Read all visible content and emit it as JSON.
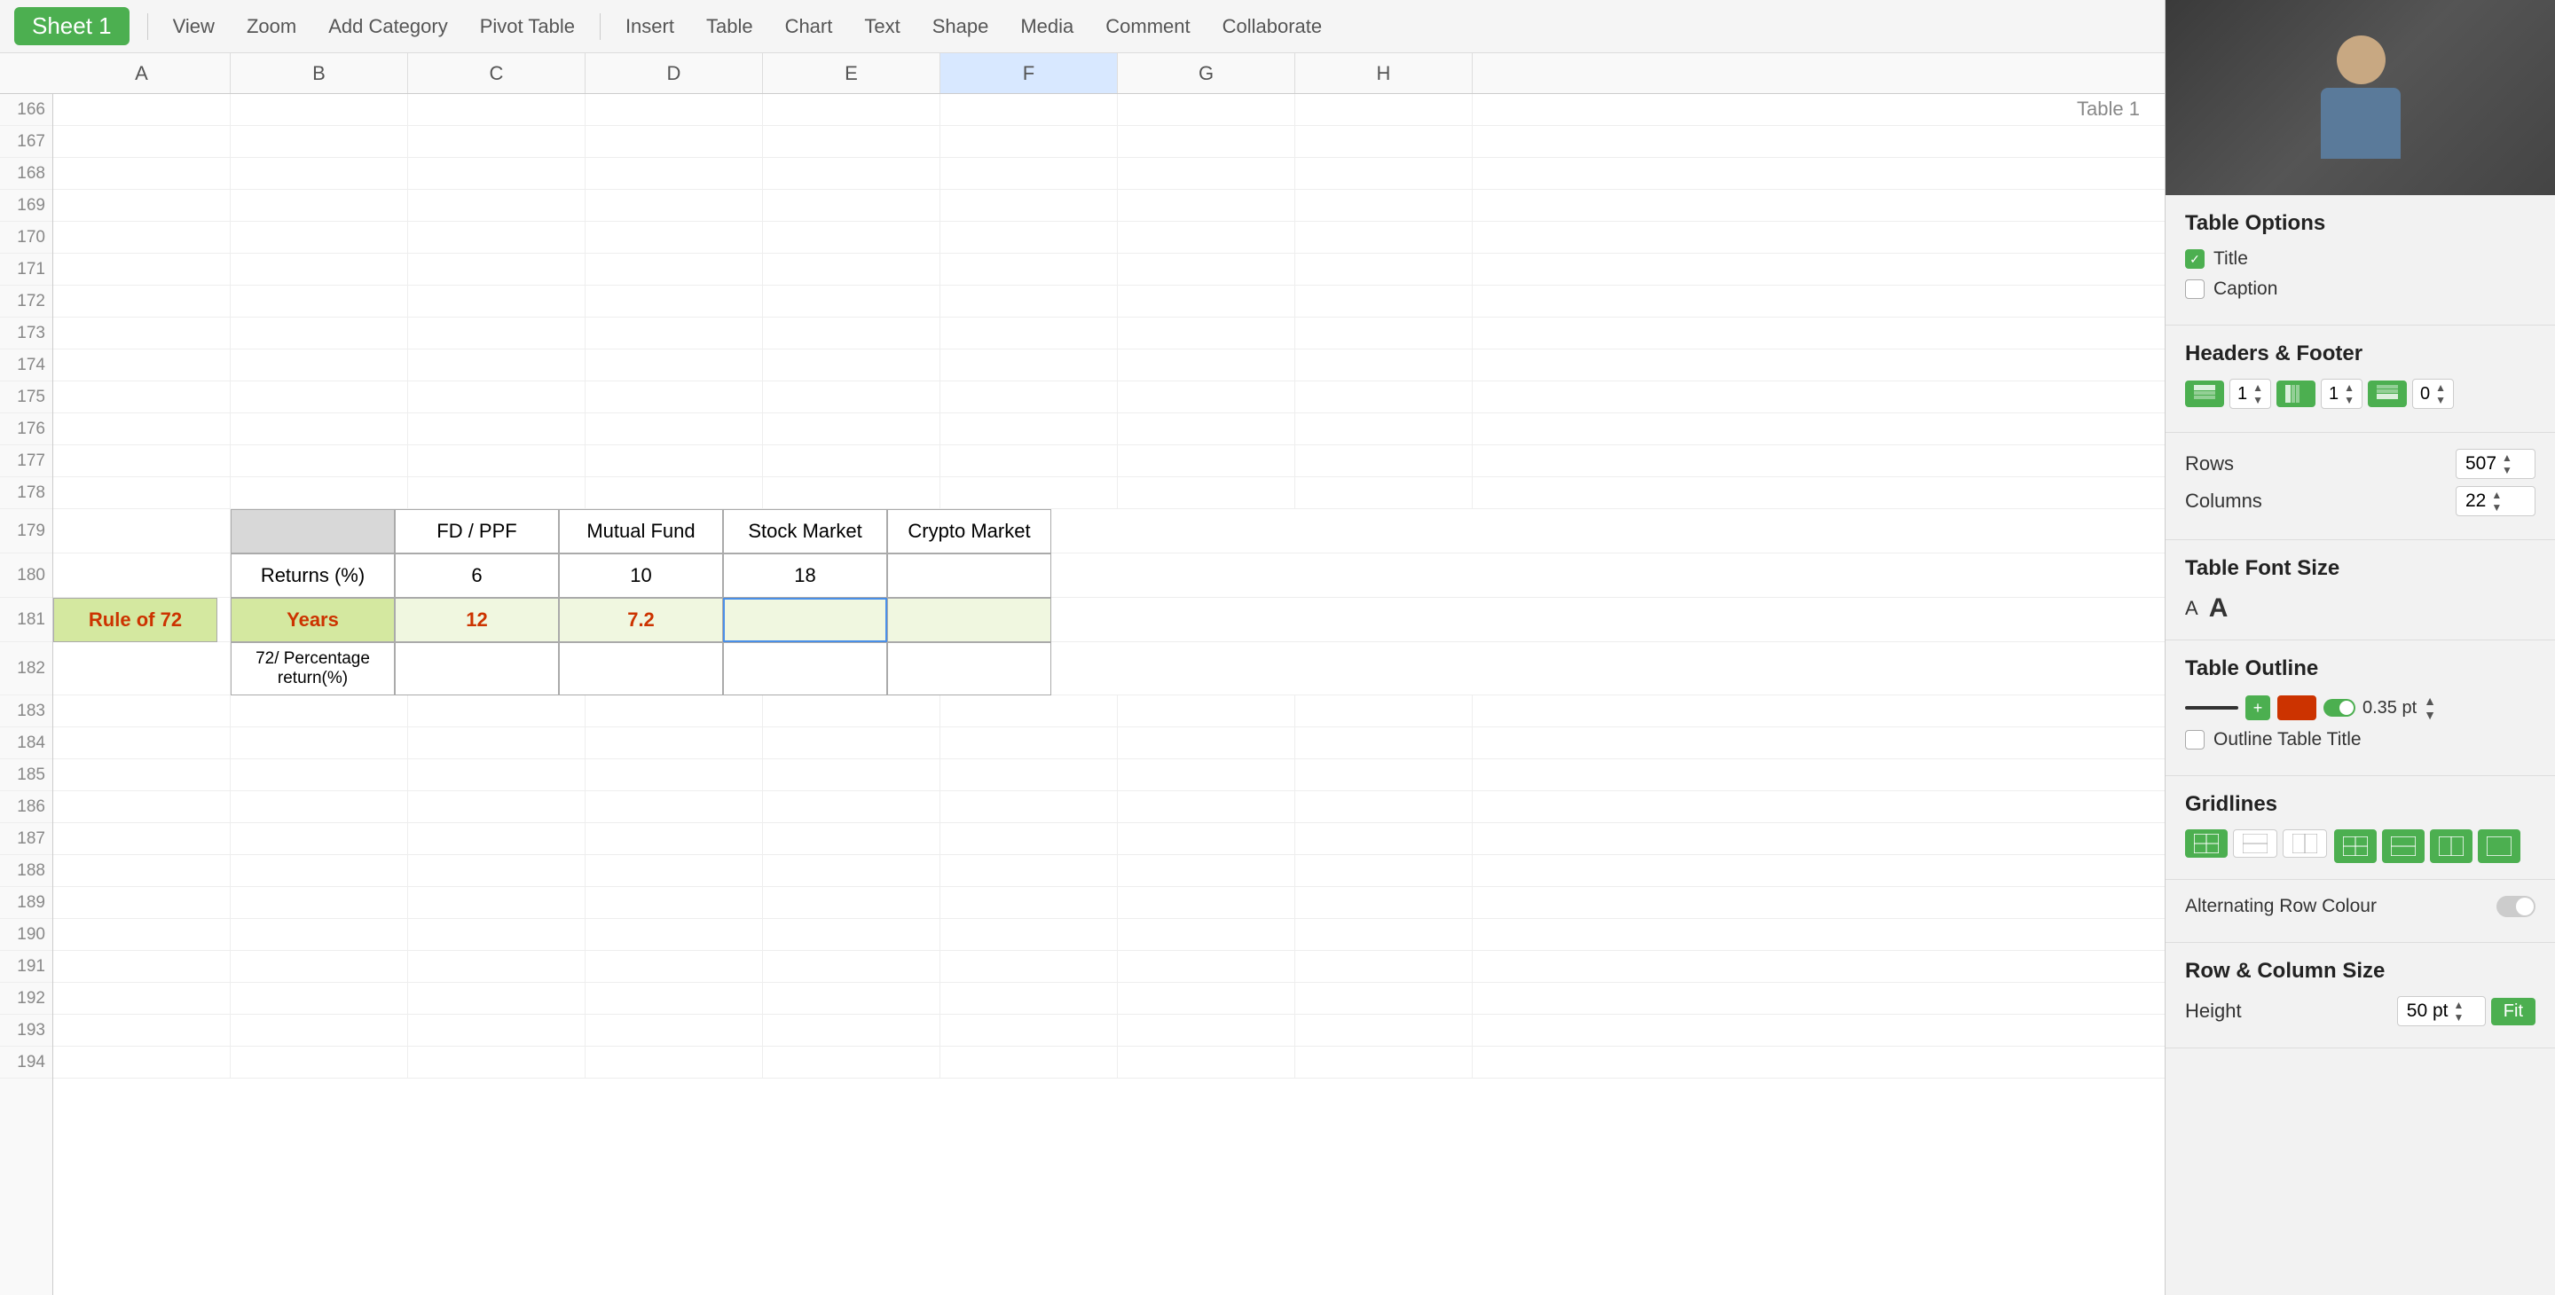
{
  "toolbar": {
    "sheet_tab": "Sheet 1",
    "buttons": [
      "View",
      "Zoom",
      "Add Category",
      "Pivot Table",
      "Insert",
      "Table",
      "Chart",
      "Text",
      "Shape",
      "Media",
      "Comment",
      "Collaborate"
    ]
  },
  "column_headers": [
    "A",
    "B",
    "C",
    "D",
    "E",
    "F",
    "G",
    "H"
  ],
  "row_numbers": [
    166,
    167,
    168,
    169,
    170,
    171,
    172,
    173,
    174,
    175,
    176,
    177,
    178,
    179,
    180,
    181,
    182,
    183,
    184,
    185,
    186,
    187,
    188,
    189,
    190,
    191,
    192,
    193,
    194
  ],
  "table_title": "Table 1",
  "data_table": {
    "header_row": [
      "",
      "FD / PPF",
      "Mutual Fund",
      "Stock Market",
      "Crypto Market"
    ],
    "row_returns": [
      "Returns (%)",
      "6",
      "10",
      "18",
      ""
    ],
    "row_years": [
      "Years",
      "12",
      "7.2",
      "",
      ""
    ],
    "row_formula": [
      "72/ Percentage return(%)",
      "",
      "",
      "",
      ""
    ],
    "row_rule72_label": "Rule of 72"
  },
  "right_panel": {
    "section_table_options": {
      "title": "Table Options",
      "title_checked": true,
      "caption_checked": false,
      "title_label": "Title",
      "caption_label": "Caption"
    },
    "section_headers_footer": {
      "title": "Headers & Footer",
      "header_rows": "1",
      "header_cols": "1",
      "footer_rows": "0"
    },
    "section_rows_cols": {
      "rows_label": "Rows",
      "rows_value": "507",
      "cols_label": "Columns",
      "cols_value": "22"
    },
    "section_font_size": {
      "title": "Table Font Size",
      "small_a": "A",
      "large_a": "A"
    },
    "section_outline": {
      "title": "Table Outline",
      "weight": "0.35 pt",
      "outline_title_label": "Outline Table Title",
      "outline_title_checked": false
    },
    "section_gridlines": {
      "title": "Gridlines"
    },
    "section_alt_row": {
      "label": "Alternating Row Colour"
    },
    "section_row_col_size": {
      "title": "Row & Column Size",
      "height_label": "Height",
      "height_value": "50 pt",
      "fit_btn": "Fit"
    }
  }
}
